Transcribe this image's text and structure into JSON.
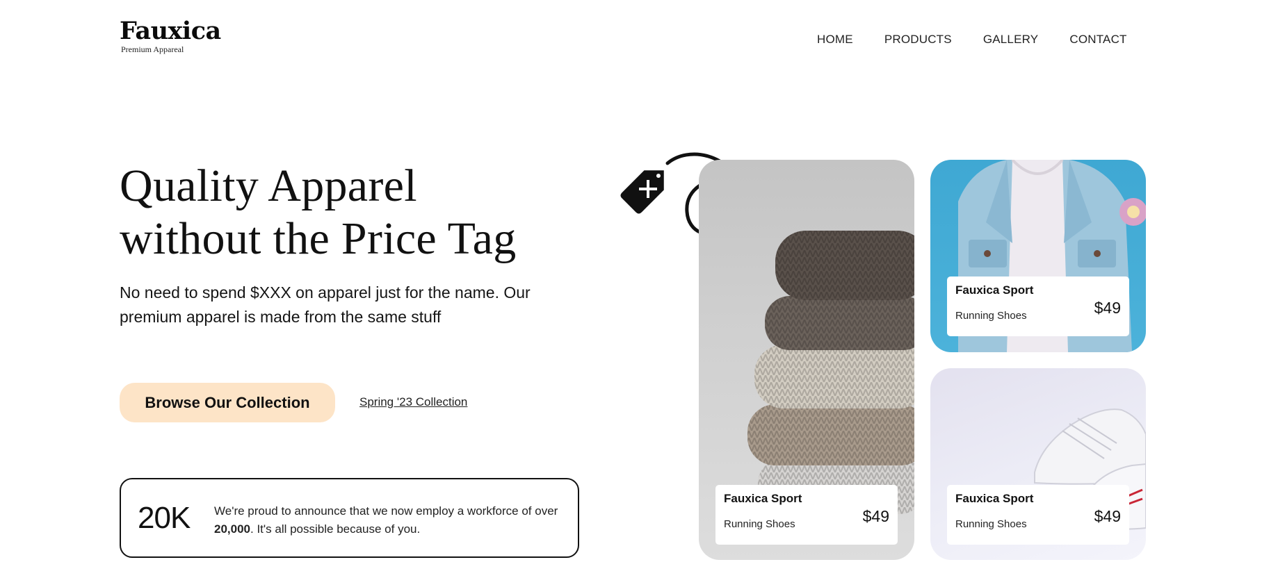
{
  "brand": {
    "name": "Fauxica",
    "tagline": "Premium Appareal"
  },
  "nav": {
    "items": [
      "HOME",
      "PRODUCTS",
      "GALLERY",
      "CONTACT"
    ]
  },
  "hero": {
    "title": "Quality Apparel without the Price Tag",
    "subtitle": "No need to spend $XXX on apparel just for the name. Our premium apparel is made from the same stuff",
    "cta_button": "Browse Our Collection",
    "cta_link": "Spring '23 Collection"
  },
  "stat": {
    "number": "20K",
    "text_before": "We're proud to announce that we now employ a workforce of over ",
    "text_bold": "20,000",
    "text_after": ". It's all possible because of you."
  },
  "products": [
    {
      "brand": "Fauxica Sport",
      "type": "Running Shoes",
      "price": "$49"
    },
    {
      "brand": "Fauxica Sport",
      "type": "Running Shoes",
      "price": "$49"
    },
    {
      "brand": "Fauxica Sport",
      "type": "Running Shoes",
      "price": "$49"
    }
  ],
  "colors": {
    "accent": "#fde4c7",
    "jacket_bg": "#45add6",
    "text": "#111111"
  },
  "icons": {
    "tag": "price-tag-icon",
    "plus": "plus-icon"
  }
}
